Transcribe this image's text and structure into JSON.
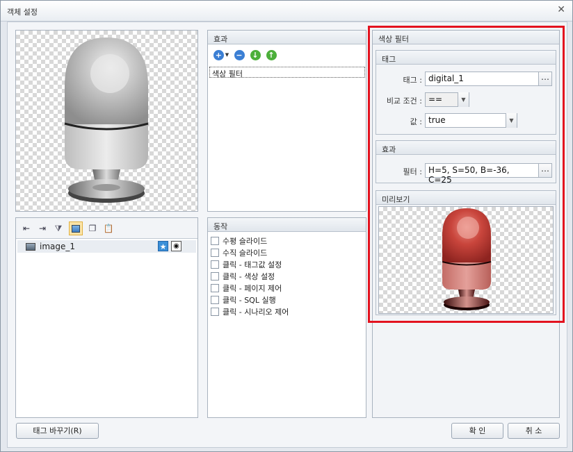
{
  "window": {
    "title": "객체 설정",
    "close_glyph": "✕"
  },
  "effects_panel": {
    "header": "효과",
    "items": [
      "색상 필터"
    ]
  },
  "objects_panel": {
    "items": [
      {
        "name": "image_1"
      }
    ]
  },
  "actions_panel": {
    "header": "동작",
    "items": [
      "수평 슬라이드",
      "수직 슬라이드",
      "클릭 - 태그값 설정",
      "클릭 - 색상 설정",
      "클릭 - 페이지 제어",
      "클릭 - SQL 실행",
      "클릭 - 시나리오 제어"
    ]
  },
  "color_filter": {
    "header": "색상 필터",
    "tag_group": {
      "header": "태그",
      "tag_label": "태그 :",
      "tag_value": "digital_1",
      "compare_label": "비교 조건 :",
      "compare_value": "==",
      "value_label": "값 :",
      "value_value": "true"
    },
    "effect_group": {
      "header": "효과",
      "filter_label": "필터 :",
      "filter_value": "H=5, S=50, B=-36, C=25"
    },
    "preview_group": {
      "header": "미리보기"
    }
  },
  "buttons": {
    "change_tag": "태그 바꾸기(R)",
    "ok": "확 인",
    "cancel": "취 소",
    "ellipsis": "…"
  },
  "colors": {
    "accent_red": "#e3131f",
    "preview_body": "#c9453c",
    "original_body": "#bfbfbf"
  }
}
